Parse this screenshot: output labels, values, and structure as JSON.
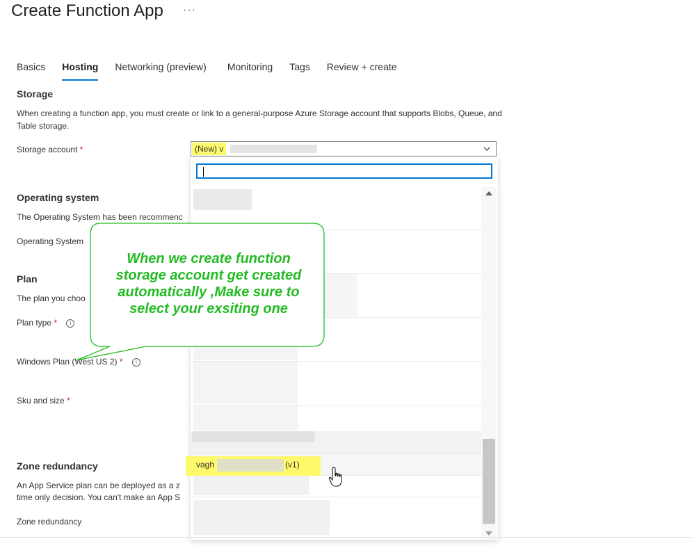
{
  "header": {
    "title": "Create Function App",
    "more_label": "···"
  },
  "tabs": [
    {
      "label": "Basics",
      "selected": false
    },
    {
      "label": "Hosting",
      "selected": true
    },
    {
      "label": "Networking (preview)",
      "selected": false
    },
    {
      "label": "Monitoring",
      "selected": false
    },
    {
      "label": "Tags",
      "selected": false
    },
    {
      "label": "Review + create",
      "selected": false
    }
  ],
  "storage": {
    "heading": "Storage",
    "description": "When creating a function app, you must create or link to a general-purpose Azure Storage account that supports Blobs, Queue, and Table storage.",
    "account_label": "Storage account",
    "required_mark": "*",
    "selected_value": "(New) v",
    "search_placeholder": "",
    "highlighted_option_prefix": "vagh",
    "highlighted_option_suffix": "(v1)"
  },
  "operating_system": {
    "heading": "Operating system",
    "description": "The Operating System has been recommenc",
    "field_label": "Operating System"
  },
  "plan": {
    "heading": "Plan",
    "description": "The plan you choo",
    "plan_type_label": "Plan type",
    "windows_plan_label": "Windows Plan (West US 2)",
    "sku_label": "Sku and size",
    "required_mark": "*"
  },
  "zone_redundancy": {
    "heading": "Zone redundancy",
    "description_line1": "An App Service plan can be deployed as a z",
    "description_line2": "time only decision. You can't make an App S",
    "field_label": "Zone redundancy"
  },
  "callout": {
    "text": "When we create function storage account get created automatically ,Make sure to select your exsiting one"
  },
  "colors": {
    "accent": "#0078d4",
    "required": "#a4262c",
    "highlight": "#fffa6b",
    "callout_green": "#22bb22"
  }
}
